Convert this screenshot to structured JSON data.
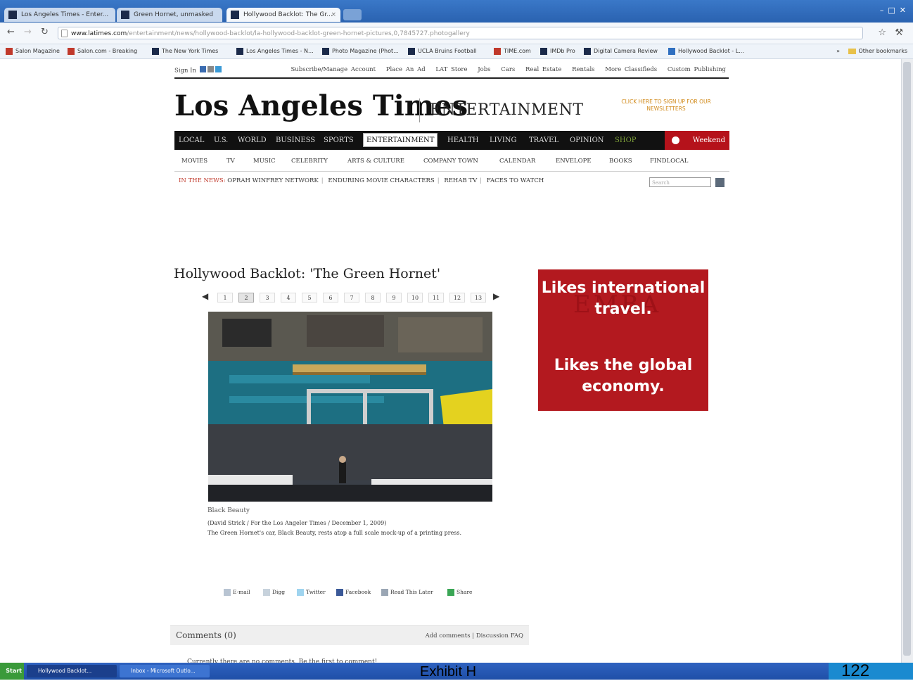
{
  "browser": {
    "tabs": [
      {
        "label": "Los Angeles Times - Enter..."
      },
      {
        "label": "Green Hornet, unmasked"
      },
      {
        "label": "Hollywood Backlot: The Gr..."
      }
    ],
    "active_tab": 2,
    "url_domain": "www.latimes.com",
    "url_rest": "/entertainment/news/hollywood-backlot/la-hollywood-backlot-green-hornet-pictures,0,7845727.photogallery",
    "bookmarks": [
      {
        "label": "Salon Magazine"
      },
      {
        "label": "Salon.com - Breaking"
      },
      {
        "label": "The New York Times"
      },
      {
        "label": "Los Angeles Times - N..."
      },
      {
        "label": "Photo Magazine (Phot..."
      },
      {
        "label": "UCLA Bruins Football"
      },
      {
        "label": "TIME.com"
      },
      {
        "label": "IMDb Pro"
      },
      {
        "label": "Digital Camera Review"
      },
      {
        "label": "Hollywood Backlot - L..."
      }
    ],
    "other_bookmarks": "Other bookmarks",
    "chevron": "»"
  },
  "site": {
    "utility": {
      "signin": "Sign In",
      "links": [
        "Subscribe/Manage Account",
        "Place An Ad",
        "LAT Store",
        "Jobs",
        "Cars",
        "Real Estate",
        "Rentals",
        "More Classifieds",
        "Custom Publishing"
      ]
    },
    "logo": "Los Angeles Times",
    "section": "ENTERTAINMENT",
    "newsletter": "CLICK HERE TO SIGN UP FOR OUR NEWSLETTERS",
    "mainnav": [
      "LOCAL",
      "U.S.",
      "WORLD",
      "BUSINESS",
      "SPORTS",
      "ENTERTAINMENT",
      "HEALTH",
      "LIVING",
      "TRAVEL",
      "OPINION",
      "SHOP"
    ],
    "weekend": "Weekend",
    "subnav": [
      "MOVIES",
      "TV",
      "MUSIC",
      "CELEBRITY",
      "ARTS & CULTURE",
      "COMPANY TOWN",
      "CALENDAR",
      "ENVELOPE",
      "BOOKS",
      "FINDLOCAL"
    ],
    "in_the_news": {
      "label": "IN THE NEWS:",
      "items": [
        "OPRAH WINFREY NETWORK",
        "ENDURING MOVIE CHARACTERS",
        "REHAB TV",
        "FACES TO WATCH"
      ]
    },
    "search_placeholder": "Search"
  },
  "article": {
    "title": "Hollywood Backlot: 'The Green Hornet'",
    "pages": [
      "1",
      "2",
      "3",
      "4",
      "5",
      "6",
      "7",
      "8",
      "9",
      "10",
      "11",
      "12",
      "13"
    ],
    "current_page": 2,
    "caption_title": "Black Beauty",
    "caption_credit": "(David Strick / For the Los Angeler Times / December 1, 2009)",
    "caption_text": "The Green Hornet's car, Black Beauty, rests atop a full scale mock-up of a printing press.",
    "share": [
      "E-mail",
      "Digg",
      "Twitter",
      "Facebook",
      "Read This Later",
      "Share"
    ]
  },
  "comments": {
    "title": "Comments (0)",
    "add": "Add comments",
    "faq": "Discussion FAQ",
    "empty": "Currently there are no comments. Be the first to comment!"
  },
  "ad": {
    "line1": "Likes international travel.",
    "line2": "Likes the global economy.",
    "background": "#b3191f"
  },
  "taskbar": {
    "start": "Start",
    "items": [
      "Hollywood Backlot...",
      "Inbox - Microsoft Outlo..."
    ]
  },
  "overlay": {
    "exhibit": "Exhibit H",
    "page_number": "122"
  },
  "colors": {
    "nav_bg": "#111111",
    "accent_red": "#b5121b",
    "chrome_blue": "#2a62b0"
  }
}
